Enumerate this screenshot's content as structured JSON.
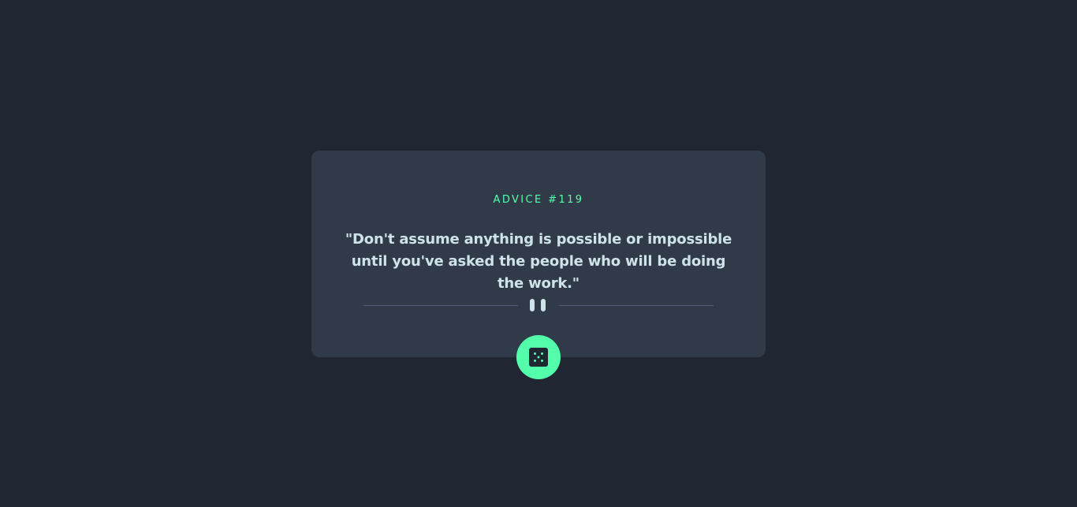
{
  "advice": {
    "label": "ADVICE #119",
    "quote": "\"Don't assume anything is possible or impossible until you've asked the people who will be doing the work.\""
  },
  "divider": {
    "icon": "pause-quotes-icon"
  },
  "dice_button": {
    "icon": "dice-icon"
  },
  "colors": {
    "background": "#202632",
    "card": "#313a48",
    "accent": "#53ffaa",
    "text": "#cee3e9",
    "divider": "#4f5d74"
  }
}
